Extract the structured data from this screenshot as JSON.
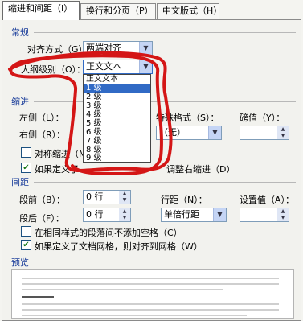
{
  "tabs": [
    {
      "label": "缩进和间距（I）"
    },
    {
      "label": "换行和分页（P）"
    },
    {
      "label": "中文版式（H）"
    }
  ],
  "general": {
    "title": "常规",
    "alignment": {
      "label": "对齐方式（G）：",
      "value": "两端对齐"
    },
    "outline": {
      "label": "大纲级别（O）：",
      "value": "正文文本",
      "options": [
        "正文文本",
        "1 级",
        "2 级",
        "3 级",
        "4 级",
        "5 级",
        "6 级",
        "7 级",
        "8 级",
        "9 级"
      ],
      "selected_index": 1
    }
  },
  "indent": {
    "title": "缩进",
    "left": {
      "label": "左侧（L）："
    },
    "right": {
      "label": "右侧（R）："
    },
    "special": {
      "label": "特殊格式（S）：",
      "value": "（无）"
    },
    "by": {
      "label": "磅值（Y）："
    },
    "mirror": {
      "label": "对称缩进（M）",
      "checked": false
    },
    "auto_adjust": {
      "label": "如果定义了文档网格，则自动调整右缩进（D）",
      "visible_text": "调整右缩进（D）",
      "checked": true
    }
  },
  "spacing": {
    "title": "间距",
    "before": {
      "label": "段前（B）：",
      "value": "0 行"
    },
    "after": {
      "label": "段后（F）：",
      "value": "0 行"
    },
    "line_spacing": {
      "label": "行距（N）：",
      "value": "单倍行距"
    },
    "at": {
      "label": "设置值（A）："
    },
    "no_space_same_style": {
      "label": "在相同样式的段落间不添加空格（C）",
      "checked": false
    },
    "snap_to_grid": {
      "label": "如果定义了文档网格，则对齐到网格（W）",
      "checked": true
    }
  },
  "preview": {
    "title": "预览"
  },
  "colors": {
    "accent": "#316ac5",
    "section_title": "#1a3d9a",
    "scribble": "#d41616"
  }
}
